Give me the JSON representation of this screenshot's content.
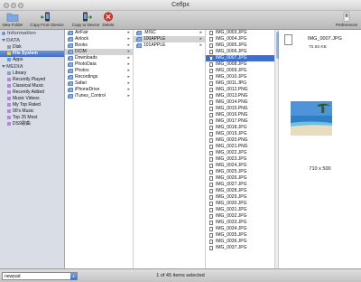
{
  "window": {
    "title": "Ceflpx"
  },
  "toolbar": {
    "new_folder": "New Folder",
    "copy_from": "Copy From Device",
    "copy_to": "Copy to Device",
    "delete": "Delete",
    "preferences": "Preferences"
  },
  "sidebar": {
    "information": "Information",
    "data": "DATA",
    "data_items": [
      "Disk",
      "File System",
      "Apps"
    ],
    "media": "MEDIA",
    "media_items": [
      "Library",
      "Recently Played",
      "Classical Music",
      "Recently Added",
      "Music Videos",
      "My Top Rated",
      "90's Music",
      "Top 25 Most",
      "DS9歌曲"
    ]
  },
  "column1": [
    "AirFair",
    "Airlock",
    "Books",
    "DCIM",
    "Downloads",
    "PhotoData",
    "Photos",
    "Recordings",
    "Safari",
    "iPhoneDrive",
    "iTunes_Control"
  ],
  "column2": [
    ".MISC",
    "100APPLE",
    "101APPLE"
  ],
  "column3": [
    "IMG_0003.JPG",
    "IMG_0004.JPG",
    "IMG_0005.JPG",
    "IMG_0006.JPG",
    "IMG_0007.JPG",
    "IMG_0008.JPG",
    "IMG_0009.JPG",
    "IMG_0010.JPG",
    "IMG_0011.JPG",
    "IMG_0012.PNG",
    "IMG_0013.PNG",
    "IMG_0014.PNG",
    "IMG_0015.PNG",
    "IMG_0016.PNG",
    "IMG_0017.PNG",
    "IMG_0018.JPG",
    "IMG_0019.JPG",
    "IMG_0020.PNG",
    "IMG_0021.PNG",
    "IMG_0022.JPG",
    "IMG_0023.JPG",
    "IMG_0024.JPG",
    "IMG_0025.JPG",
    "IMG_0026.JPG",
    "IMG_0027.JPG",
    "IMG_0028.JPG",
    "IMG_0029.JPG",
    "IMG_0030.JPG",
    "IMG_0031.JPG",
    "IMG_0032.JPG",
    "IMG_0033.JPG",
    "IMG_0034.JPG",
    "IMG_0035.JPG",
    "IMG_0036.JPG",
    "IMG_0037.JPG"
  ],
  "preview": {
    "name": "IMG_0007.JPG",
    "size": "70.56 KB",
    "dimensions": "710 x 500"
  },
  "status": {
    "device": "newpad",
    "text": "1 of 45 items selected"
  },
  "colors": {
    "selection": "#3d6fd3",
    "sidebar_bg": "#d8dde6"
  }
}
